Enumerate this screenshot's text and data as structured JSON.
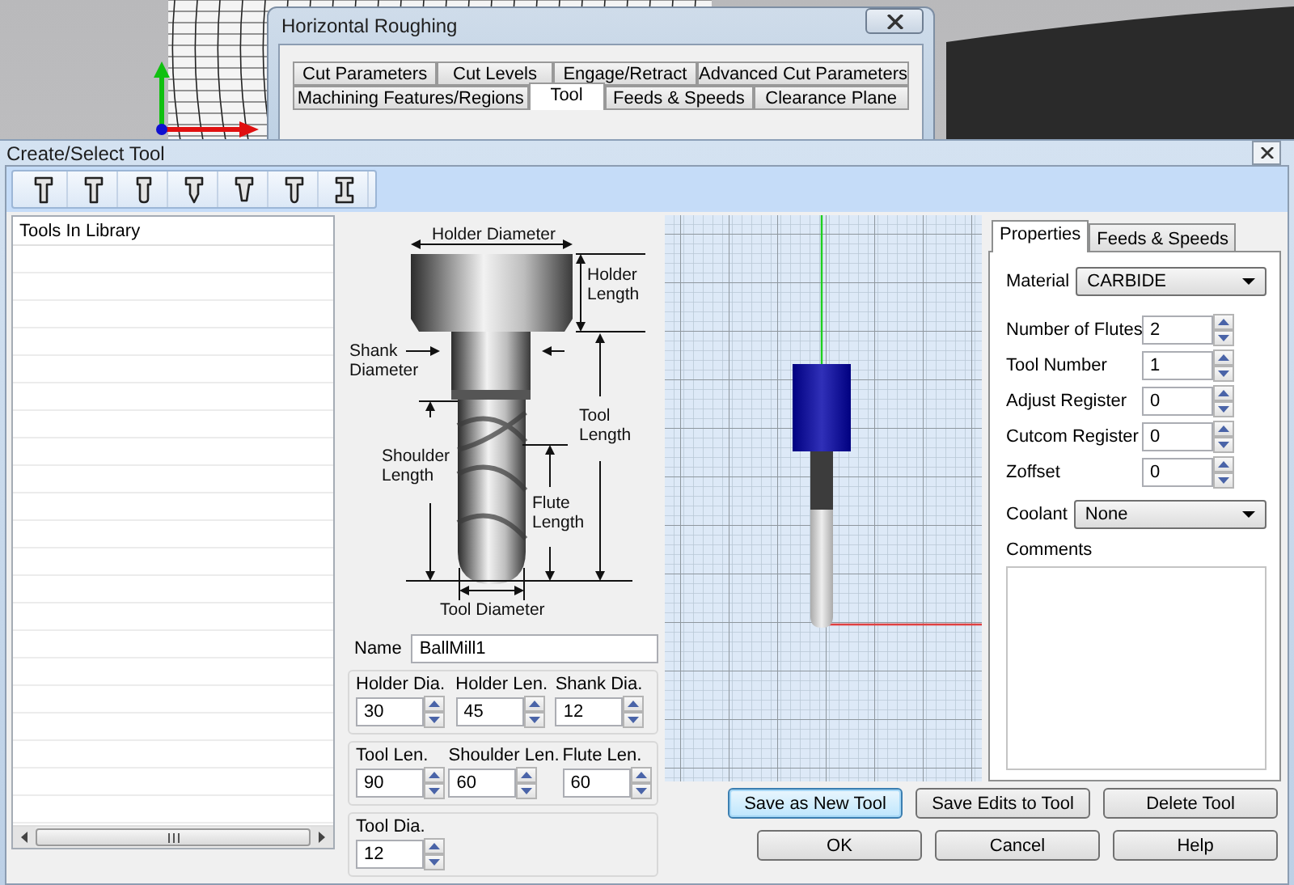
{
  "background_window": {
    "title": "Horizontal Roughing",
    "tab_rows": [
      [
        {
          "label": "Cut Parameters",
          "selected": false
        },
        {
          "label": "Cut Levels",
          "selected": false
        },
        {
          "label": "Engage/Retract",
          "selected": false
        },
        {
          "label": "Advanced Cut Parameters",
          "selected": false
        }
      ],
      [
        {
          "label": "Machining Features/Regions",
          "selected": false
        },
        {
          "label": "Tool",
          "selected": true
        },
        {
          "label": "Feeds & Speeds",
          "selected": false
        },
        {
          "label": "Clearance Plane",
          "selected": false
        }
      ]
    ]
  },
  "dialog": {
    "title": "Create/Select Tool"
  },
  "toolbar": {
    "tools": [
      {
        "kind": "flat"
      },
      {
        "kind": "flat"
      },
      {
        "kind": "bull"
      },
      {
        "kind": "drill"
      },
      {
        "kind": "taper"
      },
      {
        "kind": "ball"
      },
      {
        "kind": "undercut"
      }
    ]
  },
  "library": {
    "header": "Tools In Library"
  },
  "diagram": {
    "labels": [
      "Holder Diameter",
      "Holder Length",
      "Shank Diameter",
      "Tool Length",
      "Shoulder Length",
      "Flute Length",
      "Tool Diameter"
    ]
  },
  "name_field": {
    "label": "Name",
    "value": "BallMill1"
  },
  "dimension_groups": [
    [
      {
        "label": "Holder Dia.",
        "value": "30"
      },
      {
        "label": "Holder Len.",
        "value": "45"
      },
      {
        "label": "Shank Dia.",
        "value": "12"
      }
    ],
    [
      {
        "label": "Tool Len.",
        "value": "90"
      },
      {
        "label": "Shoulder Len.",
        "value": "60"
      },
      {
        "label": "Flute Len.",
        "value": "60"
      }
    ],
    [
      {
        "label": "Tool Dia.",
        "value": "12"
      }
    ]
  ],
  "properties": {
    "tabs": [
      {
        "label": "Properties",
        "selected": true
      },
      {
        "label": "Feeds & Speeds",
        "selected": false
      }
    ],
    "material": {
      "label": "Material",
      "value": "CARBIDE"
    },
    "fields": [
      {
        "label": "Number of Flutes",
        "value": "2"
      },
      {
        "label": "Tool Number",
        "value": "1"
      },
      {
        "label": "Adjust Register",
        "value": "0"
      },
      {
        "label": "Cutcom Register",
        "value": "0"
      },
      {
        "label": "Zoffset",
        "value": "0"
      }
    ],
    "coolant": {
      "label": "Coolant",
      "value": "None"
    },
    "comments": {
      "label": "Comments"
    }
  },
  "buttons": [
    [
      {
        "label": "Save as New Tool",
        "focused": true
      },
      {
        "label": "Save Edits to Tool",
        "focused": false
      },
      {
        "label": "Delete Tool",
        "focused": false
      }
    ],
    [
      {
        "label": "OK",
        "focused": false
      },
      {
        "label": "Cancel",
        "focused": false
      },
      {
        "label": "Help",
        "focused": false
      }
    ]
  ]
}
